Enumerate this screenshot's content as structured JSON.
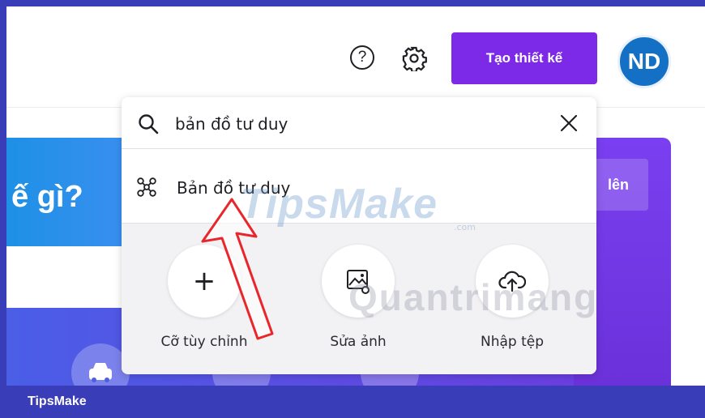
{
  "header": {
    "help_icon": "question-circle-icon",
    "settings_icon": "gear-icon",
    "create_label": "Tạo thiết kế",
    "avatar_initials": "ND"
  },
  "background": {
    "hero_text": "ế gì?",
    "upload_label": "lên"
  },
  "search": {
    "value": "bản đồ tư duy",
    "icon": "search-icon",
    "clear_icon": "close-icon"
  },
  "suggestion": {
    "icon": "mind-map-icon",
    "label": "Bản đồ tư duy"
  },
  "actions": [
    {
      "label": "Cỡ tùy chỉnh",
      "icon": "plus-icon"
    },
    {
      "label": "Sửa ảnh",
      "icon": "image-edit-icon"
    },
    {
      "label": "Nhập tệp",
      "icon": "cloud-upload-icon"
    }
  ],
  "watermark": {
    "tipsmake": "TipsMake",
    "com": ".com",
    "quantrimang": "Quantrimang"
  },
  "footer": {
    "brand": "TipsMake"
  },
  "colors": {
    "accent": "#7d2ae8",
    "avatar": "#1370c4",
    "frame": "#3a3db8"
  }
}
